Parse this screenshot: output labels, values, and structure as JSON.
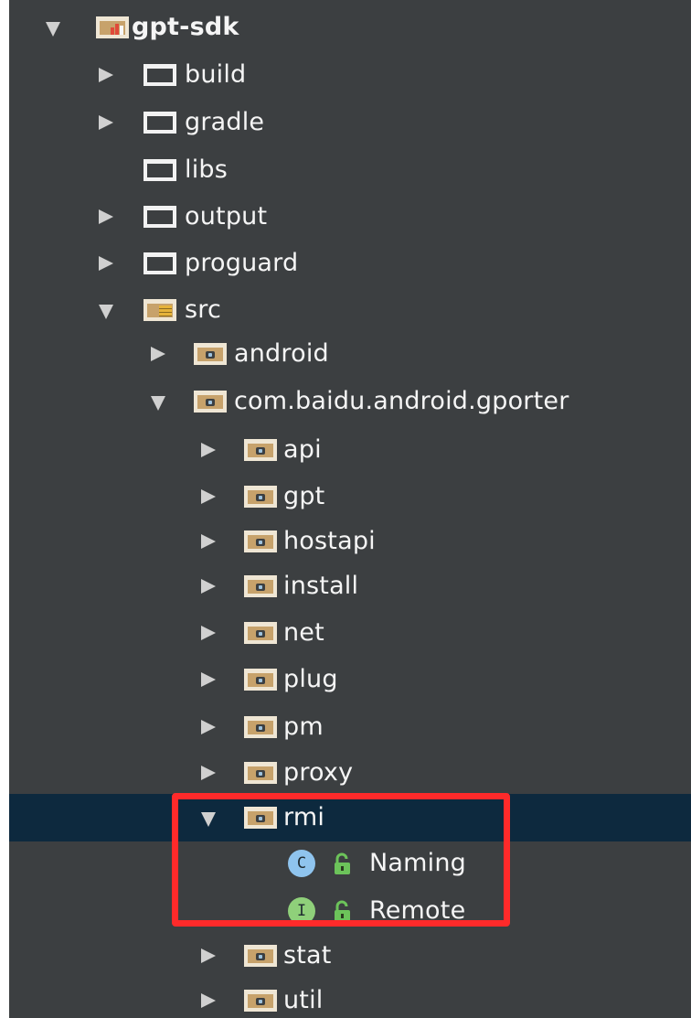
{
  "tree": {
    "items": [
      {
        "label": "gpt-sdk",
        "depth": 0,
        "expanded": true,
        "icon": "module-folder-icon",
        "arrow": "down"
      },
      {
        "label": "build",
        "depth": 1,
        "icon": "folder-icon",
        "arrow": "right"
      },
      {
        "label": "gradle",
        "depth": 1,
        "icon": "folder-icon",
        "arrow": "right"
      },
      {
        "label": "libs",
        "depth": 1,
        "icon": "folder-icon",
        "arrow": "none"
      },
      {
        "label": "output",
        "depth": 1,
        "icon": "folder-icon",
        "arrow": "right"
      },
      {
        "label": "proguard",
        "depth": 1,
        "icon": "folder-icon",
        "arrow": "right"
      },
      {
        "label": "src",
        "depth": 1,
        "icon": "source-folder-icon",
        "arrow": "down"
      },
      {
        "label": "android",
        "depth": 2,
        "icon": "package-icon",
        "arrow": "right"
      },
      {
        "label": "com.baidu.android.gporter",
        "depth": 2,
        "icon": "package-icon",
        "arrow": "down"
      },
      {
        "label": "api",
        "depth": 3,
        "icon": "package-icon",
        "arrow": "right"
      },
      {
        "label": "gpt",
        "depth": 3,
        "icon": "package-icon",
        "arrow": "right"
      },
      {
        "label": "hostapi",
        "depth": 3,
        "icon": "package-icon",
        "arrow": "right"
      },
      {
        "label": "install",
        "depth": 3,
        "icon": "package-icon",
        "arrow": "right"
      },
      {
        "label": "net",
        "depth": 3,
        "icon": "package-icon",
        "arrow": "right"
      },
      {
        "label": "plug",
        "depth": 3,
        "icon": "package-icon",
        "arrow": "right"
      },
      {
        "label": "pm",
        "depth": 3,
        "icon": "package-icon",
        "arrow": "right"
      },
      {
        "label": "proxy",
        "depth": 3,
        "icon": "package-icon",
        "arrow": "right"
      },
      {
        "label": "rmi",
        "depth": 3,
        "icon": "package-icon",
        "arrow": "down",
        "selected": true
      },
      {
        "label": "Naming",
        "depth": 4,
        "icon": "class-icon",
        "badge": "C",
        "access": "unlocked-icon"
      },
      {
        "label": "Remote",
        "depth": 4,
        "icon": "interface-icon",
        "badge": "I",
        "access": "unlocked-icon"
      },
      {
        "label": "stat",
        "depth": 3,
        "icon": "package-icon",
        "arrow": "right"
      },
      {
        "label": "util",
        "depth": 3,
        "icon": "package-icon",
        "arrow": "right"
      }
    ]
  },
  "colors": {
    "background": "#3c3f41",
    "selection": "#0d293e",
    "highlight_border": "#ff2a2a",
    "text": "#f5f5f5"
  }
}
